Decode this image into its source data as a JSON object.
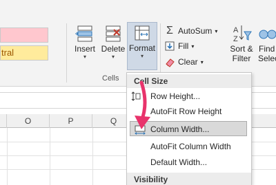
{
  "ribbon": {
    "styles": {
      "bad": "",
      "neutral": "tral"
    },
    "cells_group": {
      "label": "Cells",
      "insert": "Insert",
      "delete": "Delete",
      "format": "Format"
    },
    "editing_group": {
      "autosum": "AutoSum",
      "fill": "Fill",
      "clear": "Clear",
      "sort_filter_line1": "Sort &",
      "sort_filter_line2": "Filter",
      "find_select_line1": "Find",
      "find_select_line2": "Selec"
    }
  },
  "sheet": {
    "columns": [
      "O",
      "P",
      "Q"
    ]
  },
  "menu": {
    "section_cell_size": "Cell Size",
    "row_height": "Row Height...",
    "autofit_row_height": "AutoFit Row Height",
    "column_width": "Column Width...",
    "autofit_column_width": "AutoFit Column Width",
    "default_width": "Default Width...",
    "section_visibility": "Visibility"
  },
  "colors": {
    "highlight_arrow": "#e8336b",
    "menu_highlight": "#d9d9d9",
    "format_pressed": "#cfd9e6"
  },
  "icons": [
    "insert-cells-icon",
    "delete-cells-icon",
    "format-icon",
    "sigma-icon",
    "fill-down-icon",
    "eraser-icon",
    "sort-filter-icon",
    "binoculars-icon",
    "row-height-icon",
    "column-width-icon"
  ]
}
